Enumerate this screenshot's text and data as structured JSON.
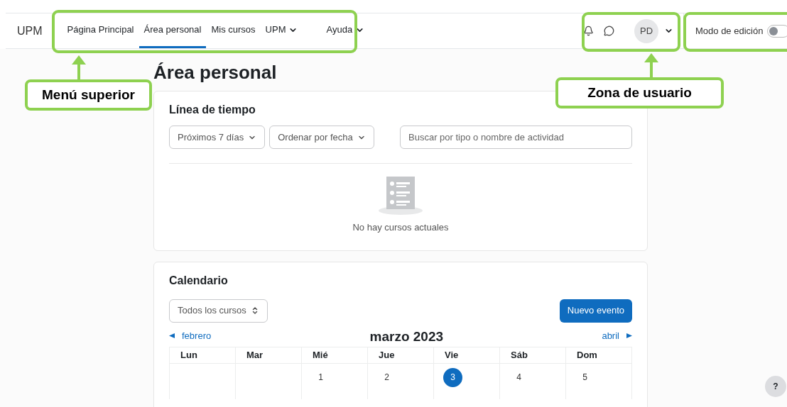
{
  "brand": "UPM",
  "nav_items": [
    {
      "label": "Página Principal",
      "selected": false,
      "dropdown": false
    },
    {
      "label": "Área personal",
      "selected": true,
      "dropdown": false
    },
    {
      "label": "Mis cursos",
      "selected": false,
      "dropdown": false
    },
    {
      "label": "UPM",
      "selected": false,
      "dropdown": true
    },
    {
      "label": "Ayuda",
      "selected": false,
      "dropdown": true
    }
  ],
  "user": {
    "initials": "PD"
  },
  "edit_mode": {
    "label": "Modo de edición",
    "on": false
  },
  "page_title": "Área personal",
  "timeline": {
    "title": "Línea de tiempo",
    "filters": [
      "Próximos 7 días",
      "Ordenar por fecha"
    ],
    "search": {
      "placeholder": "Buscar por tipo o nombre de actividad"
    },
    "empty_message": "No hay cursos actuales"
  },
  "calendar": {
    "title": "Calendario",
    "course_select": "Todos los cursos",
    "new_event_button": "Nuevo evento",
    "prev_month": "febrero",
    "next_month": "abril",
    "month": "marzo 2023",
    "weekdays": [
      "Lun",
      "Mar",
      "Mié",
      "Jue",
      "Vie",
      "Sáb",
      "Dom"
    ],
    "days": [
      {
        "kind": "blank"
      },
      {
        "kind": "blank"
      },
      {
        "kind": "day",
        "label": "1",
        "today": false
      },
      {
        "kind": "day",
        "label": "2",
        "today": false
      },
      {
        "kind": "day",
        "label": "3",
        "today": true
      },
      {
        "kind": "day",
        "label": "4",
        "today": false
      },
      {
        "kind": "day",
        "label": "5",
        "today": false
      }
    ]
  },
  "help_button": "?",
  "annotations": [
    {
      "label": "Menú superior"
    },
    {
      "label": "Zona de usuario"
    }
  ]
}
